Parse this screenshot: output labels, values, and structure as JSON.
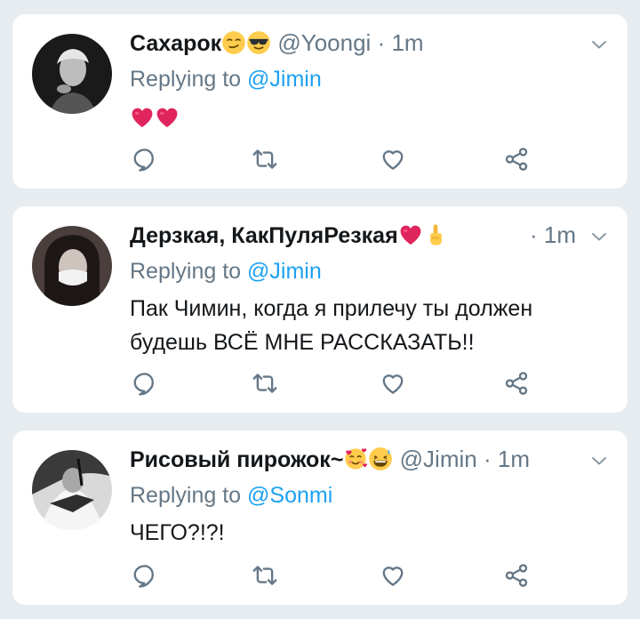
{
  "tweets": [
    {
      "name": "Сахарок",
      "name_emojis": [
        "smirking-face-emoji",
        "sunglasses-face-emoji"
      ],
      "handle": "@Yoongi",
      "separator": "·",
      "time": "1m",
      "replying_label": "Replying to",
      "replying_to": "@Jimin",
      "text_emojis": [
        "red-heart-emoji",
        "red-heart-emoji"
      ],
      "text": ""
    },
    {
      "name": "Дерзкая, КакПуляРезкая",
      "name_emojis": [
        "red-heart-emoji",
        "pointing-up-emoji"
      ],
      "handle": "",
      "separator": "·",
      "time": "1m",
      "replying_label": "Replying to",
      "replying_to": "@Jimin",
      "text": "Пак Чимин, когда я прилечу ты должен будешь ВСЁ МНЕ РАССКАЗАТЬ!!"
    },
    {
      "name": "Рисовый пирожок~",
      "name_emojis": [
        "smiling-face-with-hearts-emoji",
        "grinning-sweat-face-emoji"
      ],
      "handle": "@Jimin",
      "separator": "·",
      "time": "1m",
      "replying_label": "Replying to",
      "replying_to": "@Sonmi",
      "text": "ЧЕГО?!?!"
    }
  ],
  "icons": {
    "reply": "reply-icon",
    "retweet": "retweet-icon",
    "like": "heart-outline-icon",
    "share": "share-icon",
    "menu": "chevron-down-icon"
  },
  "colors": {
    "background": "#e6ecf0",
    "card": "#ffffff",
    "link": "#1da1f2",
    "muted": "#657786",
    "heart": "#e0245e"
  }
}
